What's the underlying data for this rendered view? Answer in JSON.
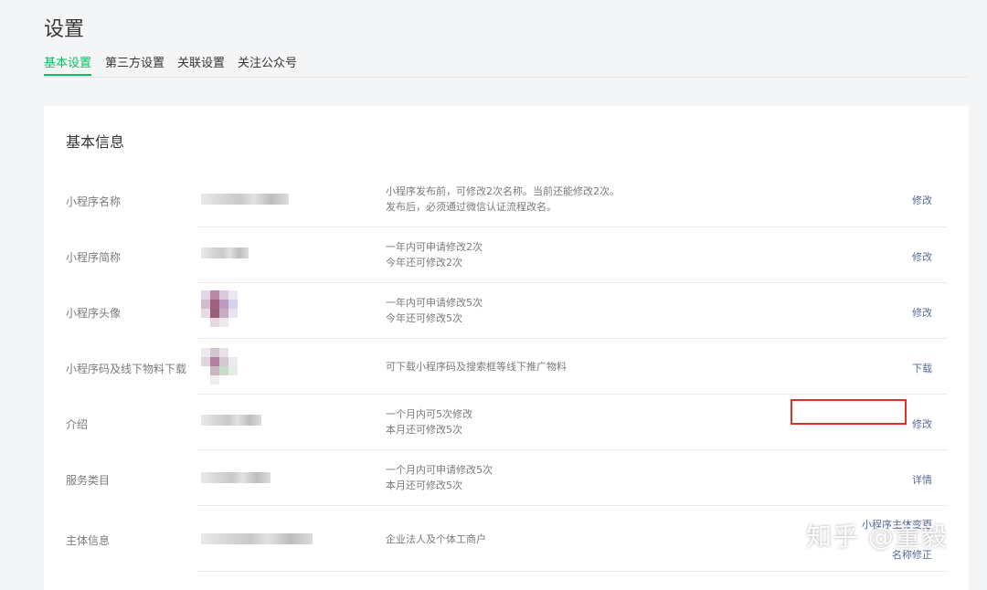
{
  "page": {
    "title": "设置"
  },
  "tabs": [
    {
      "label": "基本设置",
      "active": true
    },
    {
      "label": "第三方设置",
      "active": false
    },
    {
      "label": "关联设置",
      "active": false
    },
    {
      "label": "关注公众号",
      "active": false
    }
  ],
  "card": {
    "title": "基本信息"
  },
  "rows": [
    {
      "label": "小程序名称",
      "desc1": "小程序发布前，可修改2次名称。当前还能修改2次。",
      "desc2": "发布后，必须通过微信认证流程改名。",
      "action": "修改"
    },
    {
      "label": "小程序简称",
      "desc1": "一年内可申请修改2次",
      "desc2": "今年还可修改2次",
      "action": "修改"
    },
    {
      "label": "小程序头像",
      "desc1": "一年内可申请修改5次",
      "desc2": "今年还可修改5次",
      "action": "修改"
    },
    {
      "label": "小程序码及线下物料下载",
      "desc1": "可下载小程序码及搜索框等线下推广物料",
      "desc2": "",
      "action": "下载"
    },
    {
      "label": "介绍",
      "desc1": "一个月内可5次修改",
      "desc2": "本月还可修改5次",
      "action": "修改"
    },
    {
      "label": "服务类目",
      "desc1": "一个月内可申请修改5次",
      "desc2": "本月还可修改5次",
      "action": "详情"
    },
    {
      "label": "主体信息",
      "desc1": "企业法人及个体工商户",
      "desc2": "",
      "action": "小程序主体变更",
      "action2": "名称修正"
    }
  ],
  "watermark": "知乎 @董毅",
  "colors": {
    "accent": "#07c160",
    "link": "#576b95",
    "highlight": "#e0302a"
  }
}
